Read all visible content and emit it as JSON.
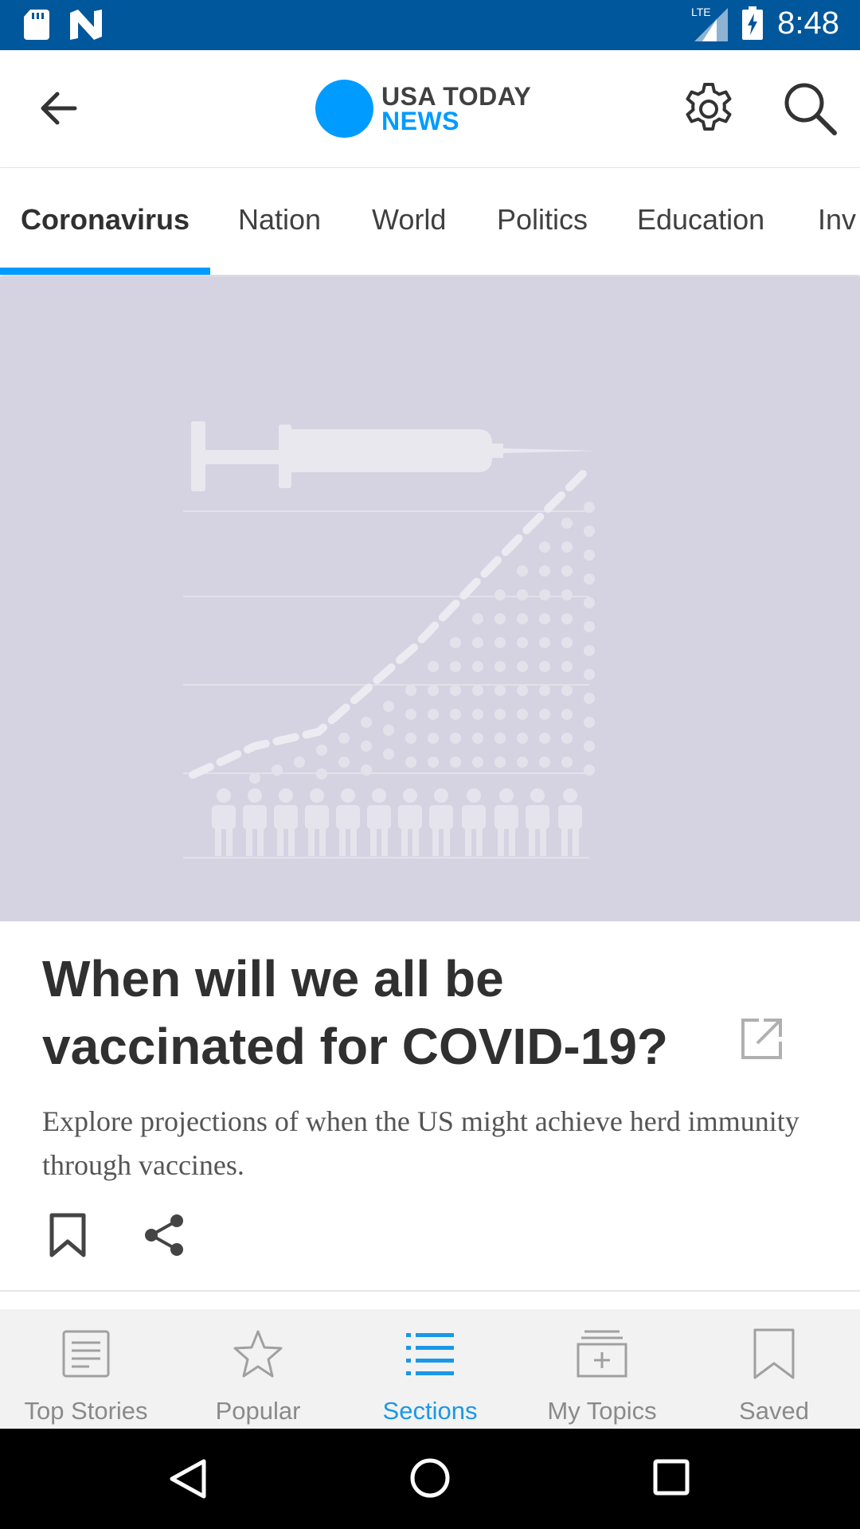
{
  "status_bar": {
    "time": "8:48",
    "network": "LTE"
  },
  "app_bar": {
    "logo_line1": "USA TODAY",
    "logo_line2": "NEWS"
  },
  "tabs": [
    {
      "label": "Coronavirus",
      "active": true
    },
    {
      "label": "Nation"
    },
    {
      "label": "World"
    },
    {
      "label": "Politics"
    },
    {
      "label": "Education"
    },
    {
      "label": "Inv"
    }
  ],
  "article": {
    "headline": "When will we all be vaccinated for COVID-19?",
    "summary": "Explore projections of when the US might achieve herd immunity through vaccines."
  },
  "bottom_nav": [
    {
      "label": "Top Stories",
      "icon": "newspaper-icon"
    },
    {
      "label": "Popular",
      "icon": "star-icon"
    },
    {
      "label": "Sections",
      "icon": "list-icon",
      "active": true
    },
    {
      "label": "My Topics",
      "icon": "topics-add-icon"
    },
    {
      "label": "Saved",
      "icon": "bookmark-icon"
    }
  ],
  "colors": {
    "accent": "#009bff",
    "status_bar": "#01579b",
    "hero_bg": "#d5d3e1"
  }
}
